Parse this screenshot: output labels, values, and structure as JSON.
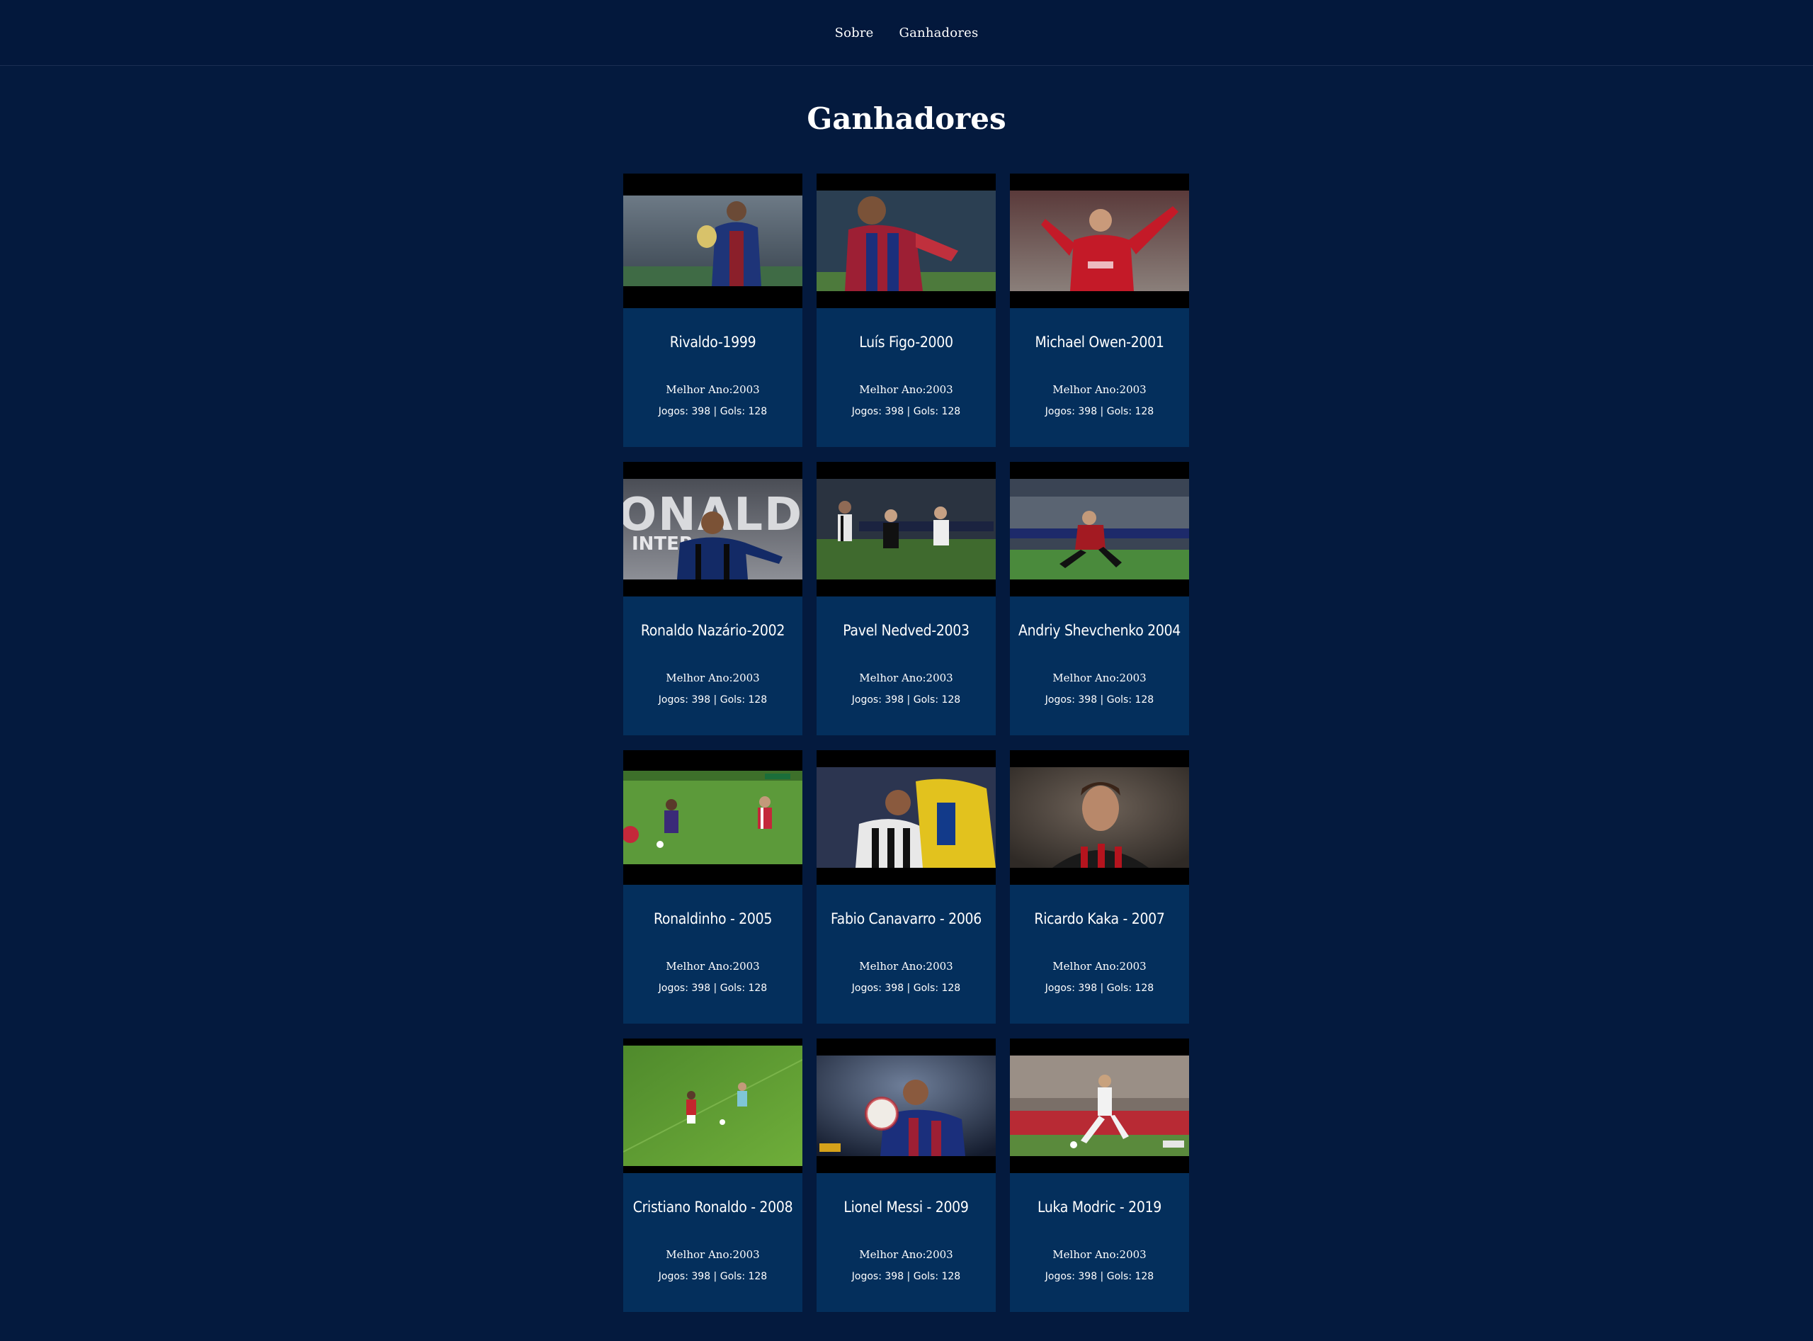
{
  "nav": {
    "items": [
      {
        "label": "Sobre"
      },
      {
        "label": "Ganhadores"
      }
    ]
  },
  "page": {
    "title": "Ganhadores"
  },
  "winners": [
    {
      "name": "Rivaldo-1999",
      "best": "Melhor Ano:2003",
      "stats": "Jogos: 398 | Gols: 128",
      "photo": "player-trophy-photo"
    },
    {
      "name": "Luís Figo-2000",
      "best": "Melhor Ano:2003",
      "stats": "Jogos: 398 | Gols: 128",
      "photo": "player-running-photo"
    },
    {
      "name": "Michael Owen-2001",
      "best": "Melhor Ano:2003",
      "stats": "Jogos: 398 | Gols: 128",
      "photo": "player-celebrating-photo"
    },
    {
      "name": "Ronaldo Nazário-2002",
      "best": "Melhor Ano:2003",
      "stats": "Jogos: 398 | Gols: 128",
      "photo": "player-poster-photo",
      "poster_text": [
        "RONALDO",
        "INTER"
      ]
    },
    {
      "name": "Pavel Nedved-2003",
      "best": "Melhor Ano:2003",
      "stats": "Jogos: 398 | Gols: 128",
      "photo": "match-action-photo"
    },
    {
      "name": "Andriy Shevchenko 2004",
      "best": "Melhor Ano:2003",
      "stats": "Jogos: 398 | Gols: 128",
      "photo": "player-shooting-photo"
    },
    {
      "name": "Ronaldinho - 2005",
      "best": "Melhor Ano:2003",
      "stats": "Jogos: 398 | Gols: 128",
      "photo": "match-dribble-photo"
    },
    {
      "name": "Fabio Canavarro - 2006",
      "best": "Melhor Ano:2003",
      "stats": "Jogos: 398 | Gols: 128",
      "photo": "player-header-photo"
    },
    {
      "name": "Ricardo Kaka - 2007",
      "best": "Melhor Ano:2003",
      "stats": "Jogos: 398 | Gols: 128",
      "photo": "player-portrait-photo"
    },
    {
      "name": "Cristiano Ronaldo - 2008",
      "best": "Melhor Ano:2003",
      "stats": "Jogos: 398 | Gols: 128",
      "photo": "pitch-overhead-photo"
    },
    {
      "name": "Lionel Messi - 2009",
      "best": "Melhor Ano:2003",
      "stats": "Jogos: 398 | Gols: 128",
      "photo": "player-with-ball-photo"
    },
    {
      "name": "Luka Modric - 2019",
      "best": "Melhor Ano:2003",
      "stats": "Jogos: 398 | Gols: 128",
      "photo": "player-kicking-photo"
    }
  ],
  "colors": {
    "background": "#041a3e",
    "nav_background": "#03183c",
    "card_background": "#042f5c",
    "text": "#ffffff"
  }
}
